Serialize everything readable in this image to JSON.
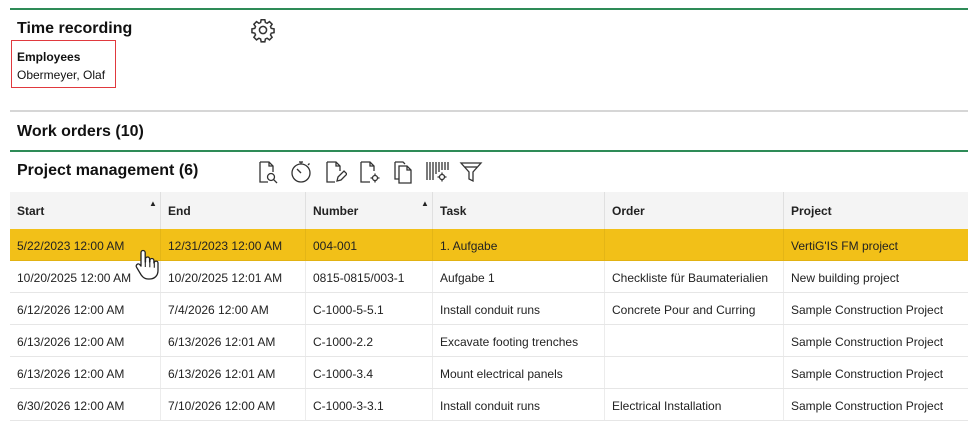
{
  "time_recording": {
    "title": "Time recording",
    "employees_label": "Employees",
    "employees_value": "Obermeyer, Olaf"
  },
  "work_orders": {
    "title": "Work orders (10)"
  },
  "project_management": {
    "title": "Project management (6)",
    "toolbar": [
      "search-document-icon",
      "timer-icon",
      "edit-document-icon",
      "document-settings-icon",
      "copy-documents-icon",
      "barcode-settings-icon",
      "filter-icon"
    ]
  },
  "table": {
    "columns": [
      "Start",
      "End",
      "Number",
      "Task",
      "Order",
      "Project"
    ],
    "rows": [
      [
        "5/22/2023 12:00 AM",
        "12/31/2023 12:00 AM",
        "004-001",
        "1. Aufgabe",
        "",
        "VertiG'IS FM project"
      ],
      [
        "10/20/2025 12:00 AM",
        "10/20/2025 12:01 AM",
        "0815-0815/003-1",
        "Aufgabe 1",
        "Checkliste für Baumaterialien",
        "New building project"
      ],
      [
        "6/12/2026 12:00 AM",
        "7/4/2026 12:00 AM",
        "C-1000-5-5.1",
        "Install conduit runs",
        "Concrete Pour and Curring",
        "Sample Construction Project"
      ],
      [
        "6/13/2026 12:00 AM",
        "6/13/2026 12:01 AM",
        "C-1000-2.2",
        "Excavate footing trenches",
        "",
        "Sample Construction Project"
      ],
      [
        "6/13/2026 12:00 AM",
        "6/13/2026 12:01 AM",
        "C-1000-3.4",
        "Mount electrical panels",
        "",
        "Sample Construction Project"
      ],
      [
        "6/30/2026 12:00 AM",
        "7/10/2026 12:00 AM",
        "C-1000-3-3.1",
        "Install conduit runs",
        "Electrical Installation",
        "Sample Construction Project"
      ]
    ]
  },
  "colors": {
    "accent_green": "#2e8b57",
    "selected_row": "#f2c018",
    "highlight_box": "#e0393e"
  }
}
